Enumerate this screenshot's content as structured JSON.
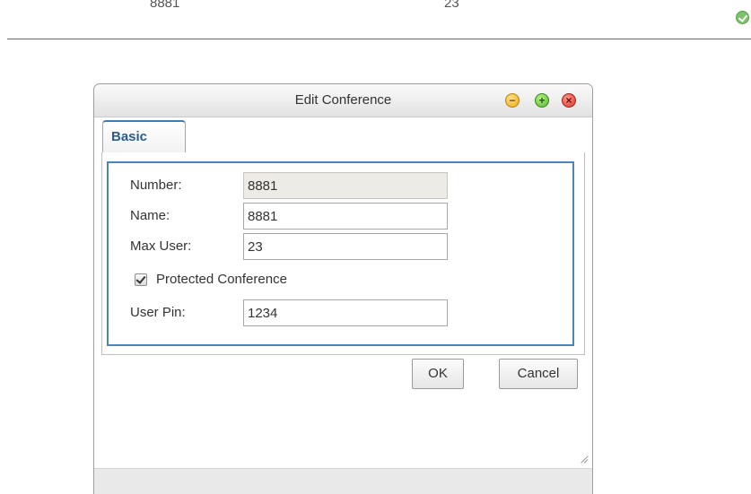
{
  "background_row": {
    "number": "8881",
    "max_user": "23",
    "status_icon": "check-circle-icon"
  },
  "dialog": {
    "title": "Edit Conference",
    "window_buttons": {
      "minimize_icon": "minimize-icon",
      "maximize_icon": "maximize-icon",
      "close_icon": "close-icon"
    },
    "tabs": [
      {
        "label": "Basic",
        "active": true
      }
    ],
    "form": {
      "number_label": "Number:",
      "number_value": "8881",
      "name_label": "Name:",
      "name_value": "8881",
      "max_user_label": "Max User:",
      "max_user_value": "23",
      "protected_label": "Protected Conference",
      "protected_checked": true,
      "user_pin_label": "User Pin:",
      "user_pin_value": "1234"
    },
    "buttons": {
      "ok_label": "OK",
      "cancel_label": "Cancel"
    }
  },
  "colors": {
    "accent_blue": "#4886bb",
    "tab_text": "#2a5c8c",
    "readonly_field": "#ecebe6",
    "minimize": "#e9a814",
    "maximize": "#52b52a",
    "close": "#d8332a",
    "status_green": "#7cc26a"
  }
}
